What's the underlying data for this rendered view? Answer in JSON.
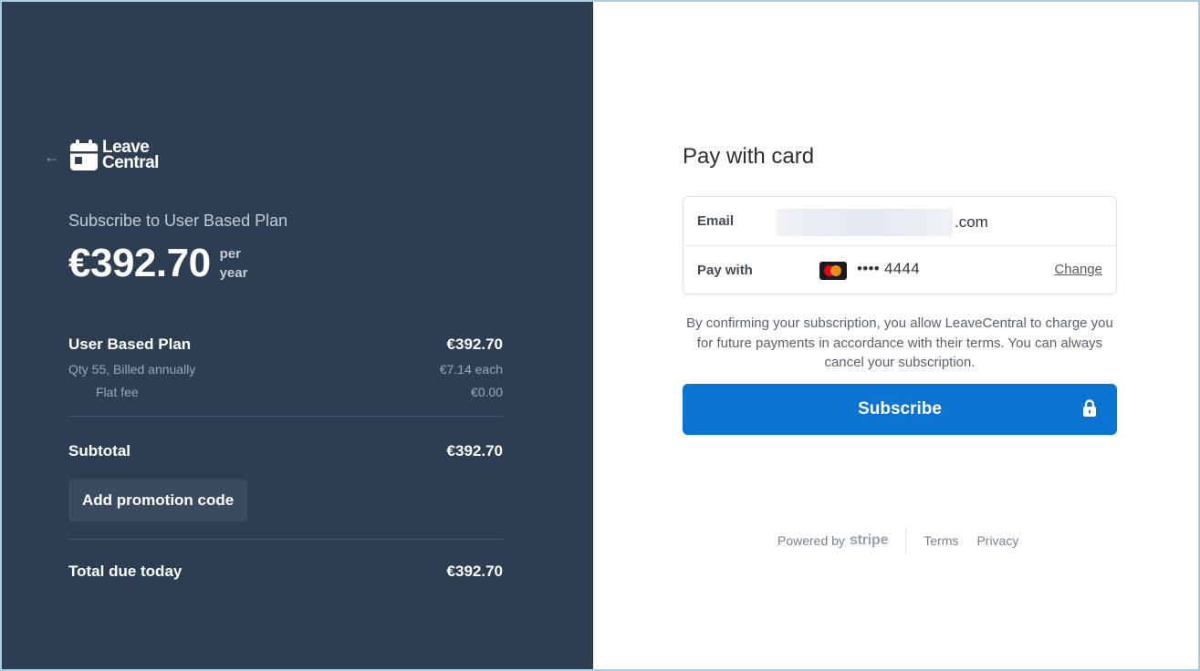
{
  "brand": {
    "name_line1": "Leave",
    "name_line2": "Central",
    "color": "#2d3e52"
  },
  "summary": {
    "title": "Subscribe to User Based Plan",
    "price": "€392.70",
    "per": "per",
    "period": "year",
    "line_item": {
      "name": "User Based Plan",
      "amount": "€392.70",
      "detail": "Qty 55, Billed annually",
      "detail_amount": "€7.14 each",
      "fee_label": "Flat fee",
      "fee_amount": "€0.00"
    },
    "subtotal_label": "Subtotal",
    "subtotal_amount": "€392.70",
    "promo_label": "Add promotion code",
    "total_label": "Total due today",
    "total_amount": "€392.70"
  },
  "payment": {
    "title": "Pay with card",
    "email_label": "Email",
    "email_visible_suffix": ".com",
    "paywith_label": "Pay with",
    "card_brand_icon": "mastercard-icon",
    "card_number": "•••• 4444",
    "change_label": "Change",
    "terms_text": "By confirming your subscription, you allow LeaveCentral to charge you for future payments in accordance with their terms. You can always cancel your subscription.",
    "subscribe_label": "Subscribe",
    "accent_color": "#0a74d0"
  },
  "footer": {
    "powered_by": "Powered by",
    "stripe": "stripe",
    "terms": "Terms",
    "privacy": "Privacy"
  }
}
